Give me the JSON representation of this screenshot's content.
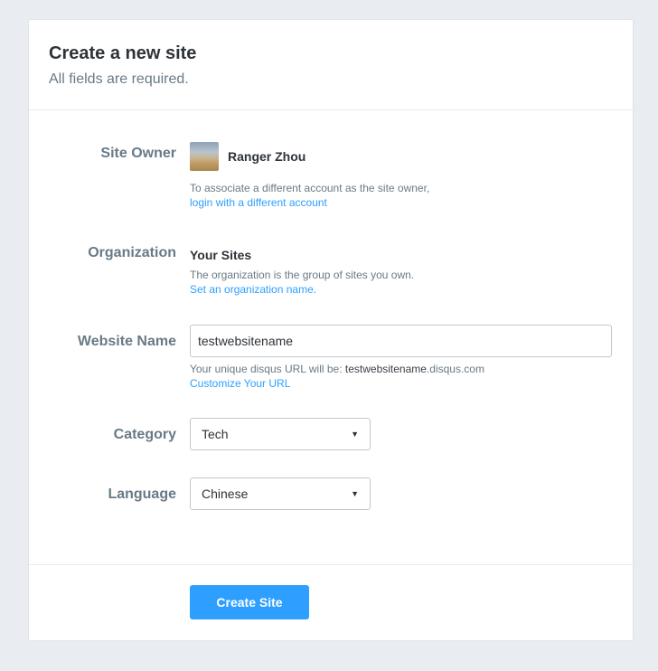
{
  "header": {
    "title": "Create a new site",
    "subtitle": "All fields are required."
  },
  "owner": {
    "label": "Site Owner",
    "name": "Ranger Zhou",
    "help": "To associate a different account as the site owner,",
    "link": "login with a different account"
  },
  "organization": {
    "label": "Organization",
    "name": "Your Sites",
    "help": "The organization is the group of sites you own.",
    "link": "Set an organization name."
  },
  "website": {
    "label": "Website Name",
    "value": "testwebsitename",
    "help_prefix": "Your unique disqus URL will be: ",
    "url_name": "testwebsitename",
    "url_suffix": ".disqus.com",
    "link": "Customize Your URL"
  },
  "category": {
    "label": "Category",
    "selected": "Tech"
  },
  "language": {
    "label": "Language",
    "selected": "Chinese"
  },
  "actions": {
    "submit_label": "Create Site"
  },
  "colors": {
    "accent": "#2e9fff",
    "background": "#e9edf1",
    "label": "#687a86"
  },
  "icons": {
    "select_caret": "caret-down-icon"
  }
}
